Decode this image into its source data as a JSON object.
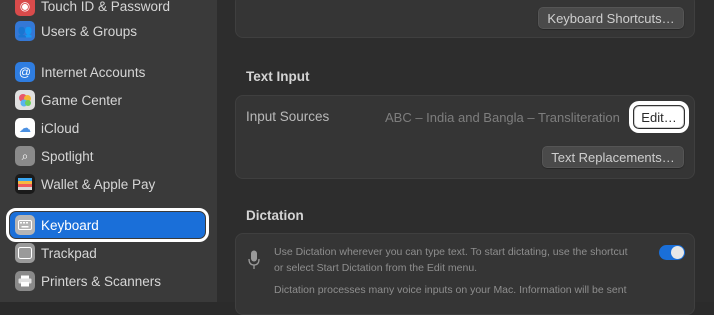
{
  "sidebar": {
    "items": [
      {
        "label": "Touch ID & Password",
        "icon": "fingerprint-icon",
        "color": "#d94b4b"
      },
      {
        "label": "Users & Groups",
        "icon": "users-icon",
        "color": "#3478d6"
      },
      {
        "label": "Internet Accounts",
        "icon": "at-icon",
        "color": "#2f7de0"
      },
      {
        "label": "Game Center",
        "icon": "game-center-icon",
        "color": "#e0e0e0"
      },
      {
        "label": "iCloud",
        "icon": "cloud-icon",
        "color": "#ffffff"
      },
      {
        "label": "Spotlight",
        "icon": "magnifier-icon",
        "color": "#8a8a8a"
      },
      {
        "label": "Wallet & Apple Pay",
        "icon": "wallet-icon",
        "color": "#1a1a1a"
      },
      {
        "label": "Keyboard",
        "icon": "keyboard-icon",
        "color": "#9a9a9a"
      },
      {
        "label": "Trackpad",
        "icon": "trackpad-icon",
        "color": "#9a9a9a"
      },
      {
        "label": "Printers & Scanners",
        "icon": "printer-icon",
        "color": "#8a8a8a"
      }
    ],
    "selected": "Keyboard",
    "accent": "#1a6fd9"
  },
  "main": {
    "keyboard_shortcuts_button": "Keyboard Shortcuts…",
    "text_input": {
      "title": "Text Input",
      "input_sources_label": "Input Sources",
      "input_sources_value": "ABC – India and Bangla – Transliteration",
      "edit_button": "Edit…",
      "text_replacements_button": "Text Replacements…"
    },
    "dictation": {
      "title": "Dictation",
      "description_line1": "Use Dictation wherever you can type text. To start dictating, use the shortcut",
      "description_line2": "or select Start Dictation from the Edit menu.",
      "description_line3": "Dictation processes many voice inputs on your Mac. Information will be sent",
      "toggle_on": true
    }
  }
}
